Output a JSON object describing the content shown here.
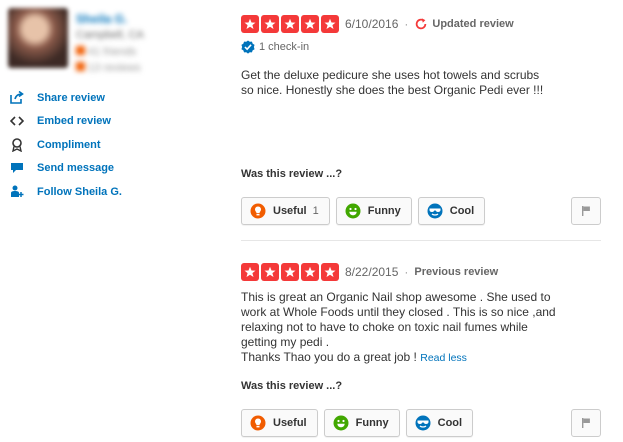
{
  "user": {
    "name": "Sheila G.",
    "location": "Campbell, CA",
    "friends": "41 friends",
    "reviews": "13 reviews"
  },
  "actions": [
    {
      "label": "Share review",
      "icon": "share-icon"
    },
    {
      "label": "Embed review",
      "icon": "embed-icon"
    },
    {
      "label": "Compliment",
      "icon": "compliment-icon"
    },
    {
      "label": "Send message",
      "icon": "message-icon"
    },
    {
      "label": "Follow Sheila G.",
      "icon": "follow-icon"
    }
  ],
  "reviews": [
    {
      "rating": 5,
      "date": "6/10/2016",
      "separator": "·",
      "status": "Updated review",
      "checkin": "1 check-in",
      "text_lines": [
        "Get the deluxe pedicure she uses hot towels and scrubs",
        "so nice. Honestly she does the best Organic Pedi ever !!!"
      ],
      "vote_label": "Was this review ...?",
      "useful_label": "Useful",
      "useful_count": "1",
      "funny_label": "Funny",
      "cool_label": "Cool"
    },
    {
      "rating": 5,
      "date": "8/22/2015",
      "separator": "·",
      "status": "Previous review",
      "text_lines": [
        "This is great an Organic Nail shop awesome . She used to",
        "work at Whole Foods until they closed . This is so nice ,and",
        "relaxing not to have to choke on toxic nail fumes while",
        "getting my pedi ."
      ],
      "last_line": "Thanks Thao you do a great job ! ",
      "read_less": "Read less",
      "vote_label": "Was this review ...?",
      "useful_label": "Useful",
      "funny_label": "Funny",
      "cool_label": "Cool"
    }
  ],
  "colors": {
    "star": "#f43939",
    "link": "#0073bb",
    "updated_icon": "#f43939",
    "checkin_badge": "#0073bb",
    "useful": "#f15c00",
    "funny": "#41a700",
    "cool": "#0073bb"
  }
}
